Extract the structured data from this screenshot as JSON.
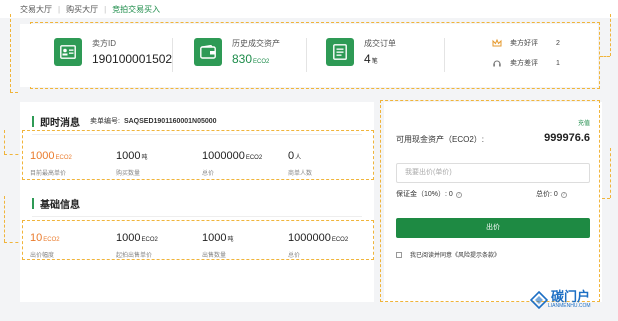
{
  "breadcrumb": [
    "交易大厅",
    "购买大厅",
    "竞拍交易买入"
  ],
  "summary": {
    "seller_id_label": "卖方ID",
    "seller_id_value": "190100001502",
    "history_label": "历史成交资产",
    "history_value": "830",
    "history_unit": "ECO2",
    "orders_label": "成交订单",
    "orders_value": "4",
    "orders_unit": "笔",
    "good_reviews_label": "卖方好评",
    "good_reviews_value": "2",
    "bad_reviews_label": "卖方差评",
    "bad_reviews_value": "1"
  },
  "realtime": {
    "title": "即时消息",
    "order_label": "卖单编号:",
    "order_no": "SAQSED1901160001N05000",
    "stats": [
      {
        "value": "1000",
        "unit": "ECO2",
        "label": "目前最高单价",
        "highlight": true
      },
      {
        "value": "1000",
        "unit": "吨",
        "label": "购买数量",
        "highlight": false
      },
      {
        "value": "1000000",
        "unit": "ECO2",
        "label": "总价",
        "highlight": false
      },
      {
        "value": "0",
        "unit": "人",
        "label": "商单人数",
        "highlight": false
      }
    ]
  },
  "basic": {
    "title": "基础信息",
    "stats": [
      {
        "value": "10",
        "unit": "ECO2",
        "label": "出价幅度",
        "highlight": true
      },
      {
        "value": "1000",
        "unit": "ECO2",
        "label": "起拍出售单价",
        "highlight": false
      },
      {
        "value": "1000",
        "unit": "吨",
        "label": "出售数量",
        "highlight": false
      },
      {
        "value": "1000000",
        "unit": "ECO2",
        "label": "总价",
        "highlight": false
      }
    ]
  },
  "bid": {
    "recharge": "充值",
    "cash_label": "可用现金资产（ECO2）:",
    "cash_value": "999976.6",
    "price_placeholder": "我要出价(单价)",
    "deposit_label": "保证金（10%）: 0",
    "total_label": "总价: 0",
    "button": "出价",
    "agree_text": "我已阅读并同意《风险提示条款》"
  },
  "watermark": {
    "text": "碳门户",
    "sub": "LIANMENHU.COM"
  },
  "colors": {
    "green": "#2e9a55",
    "orange": "#ea7b2c",
    "dash": "#f0b43a"
  }
}
